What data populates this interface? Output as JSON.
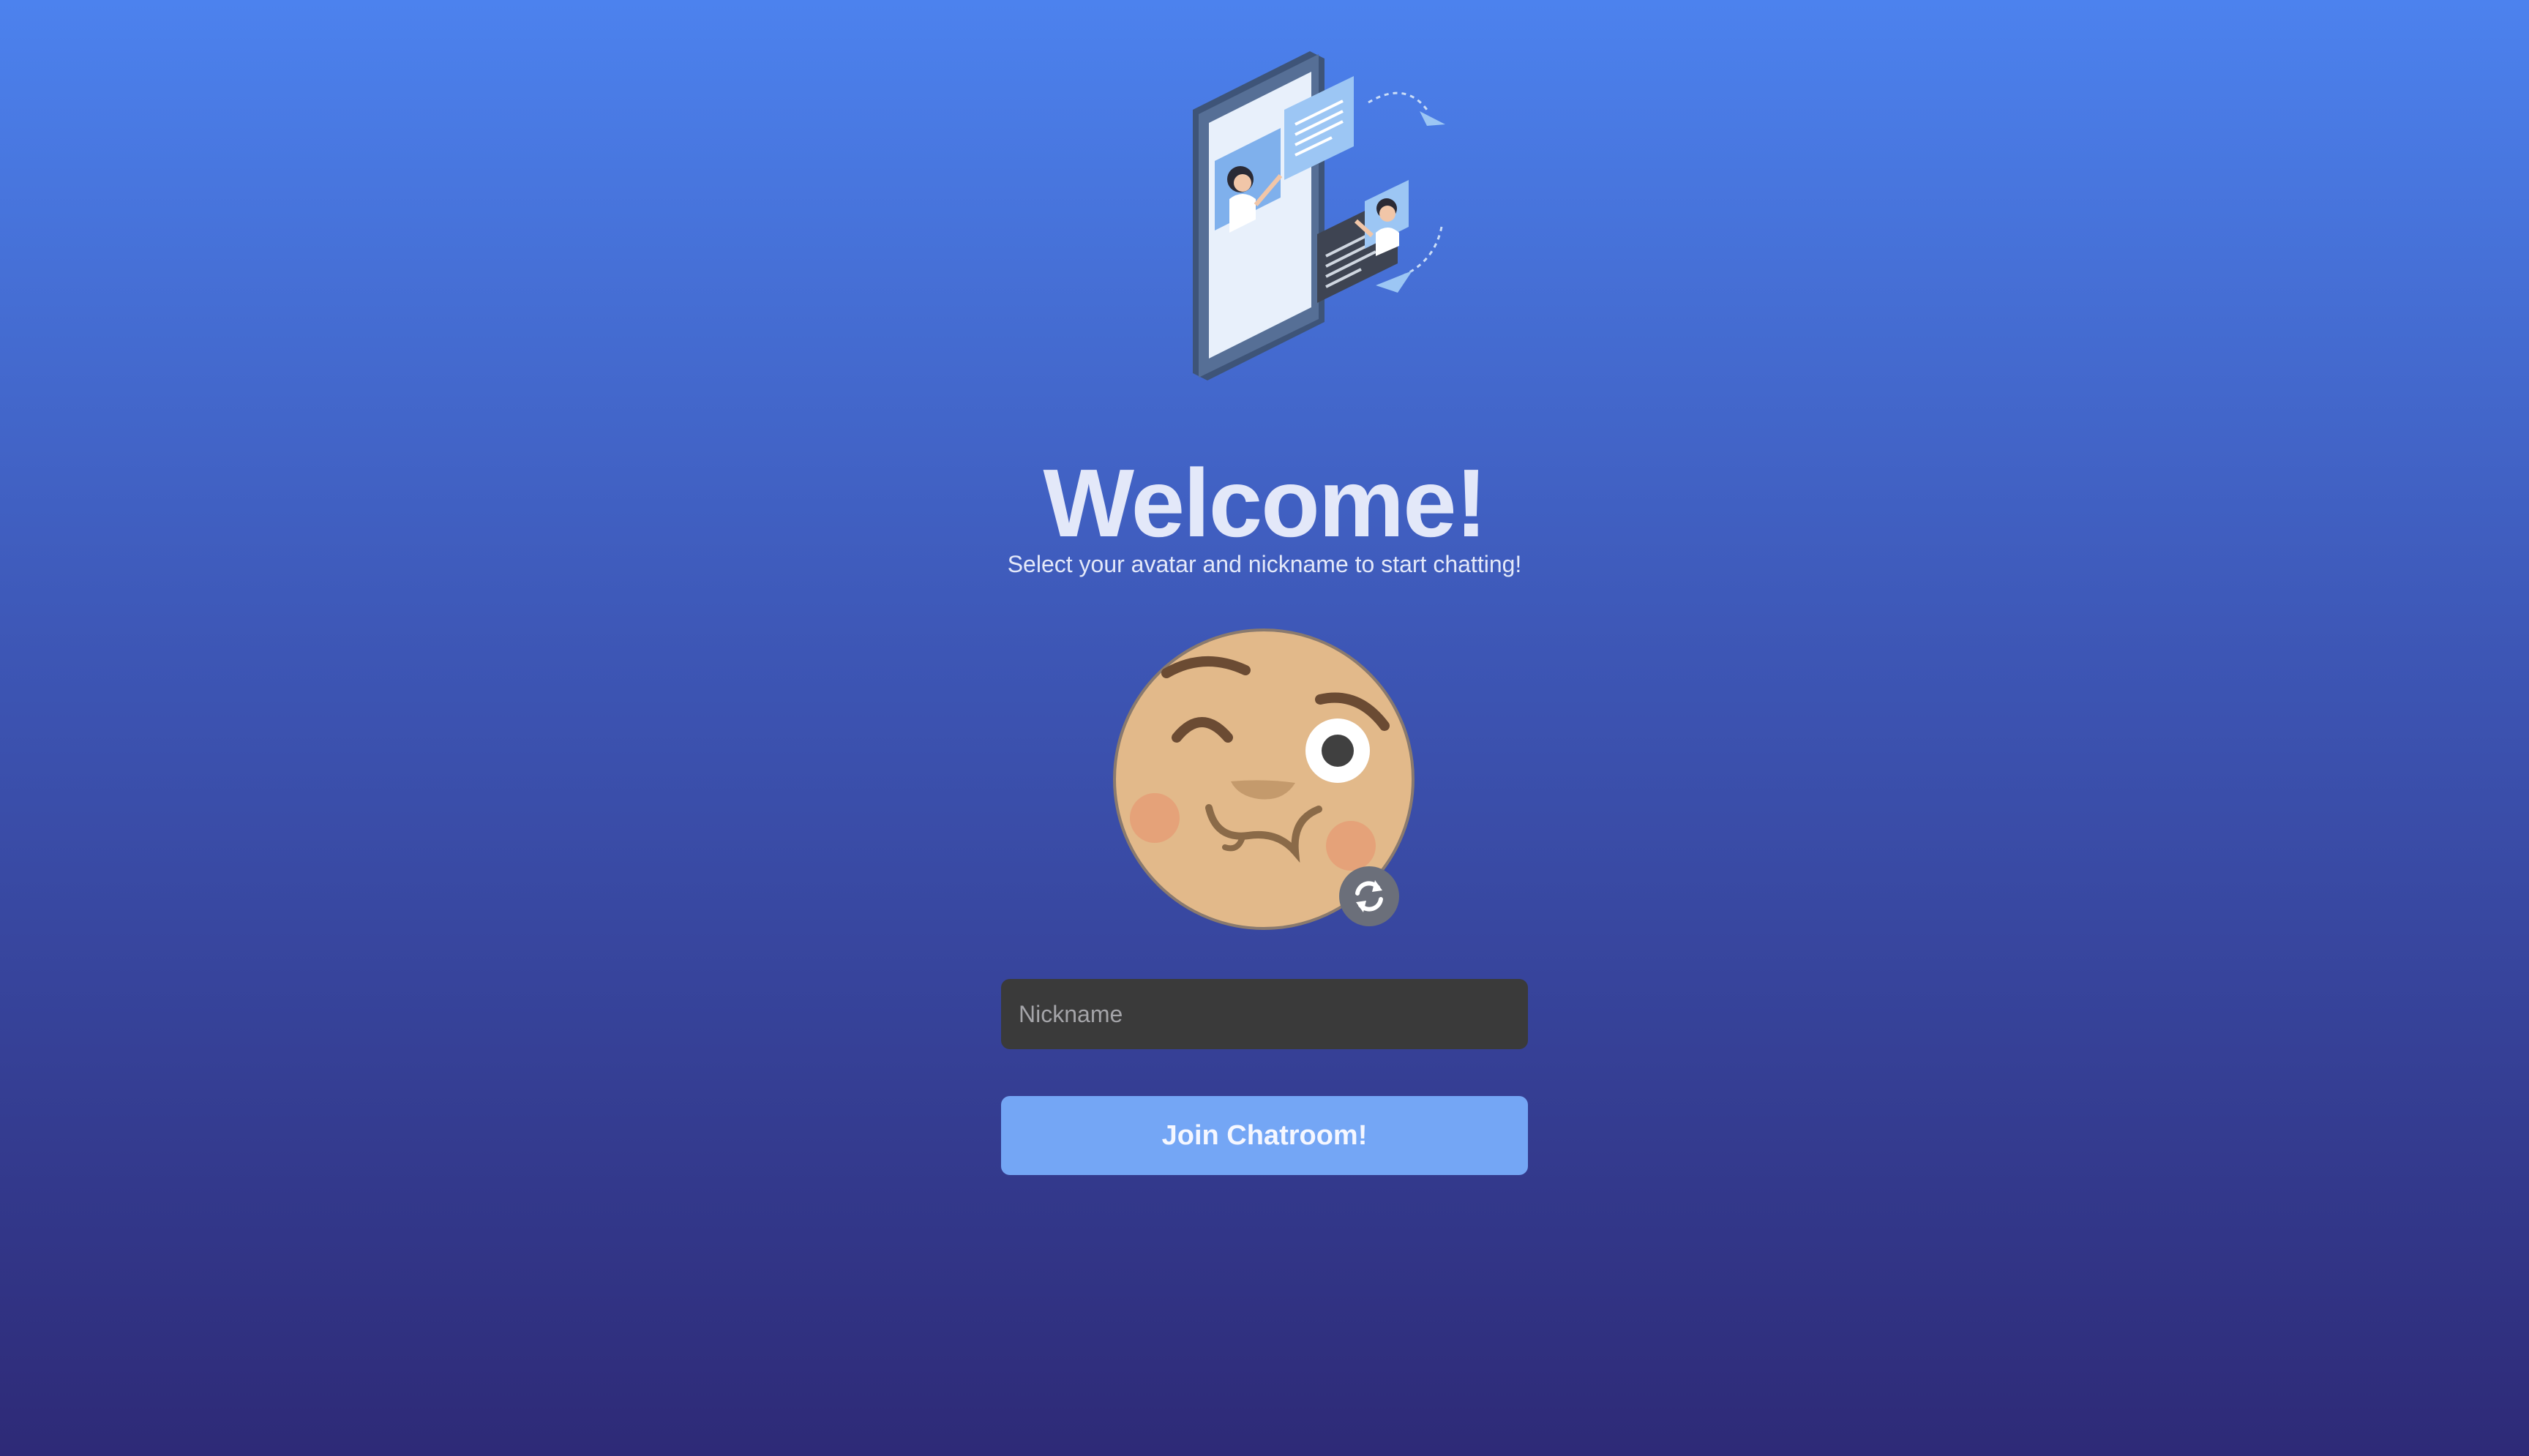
{
  "welcome": {
    "title": "Welcome!",
    "subtitle": "Select your avatar and nickname to start chatting!"
  },
  "avatar": {
    "icon": "winking-face-avatar",
    "refresh_icon": "refresh-icon"
  },
  "nickname": {
    "placeholder": "Nickname",
    "value": ""
  },
  "join": {
    "label": "Join Chatroom!"
  },
  "colors": {
    "background_top": "#4c82ee",
    "background_bottom": "#2e2a77",
    "button": "#74a6f5",
    "input_bg": "#3a3a3a"
  }
}
